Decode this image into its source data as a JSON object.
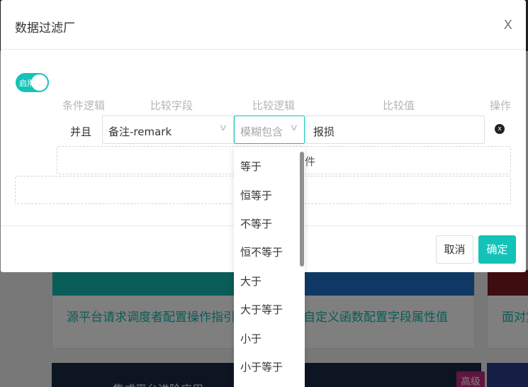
{
  "dialog": {
    "title": "数据过滤厂",
    "close_label": "X"
  },
  "toggle": {
    "label": "启用",
    "on": true
  },
  "headers": {
    "condition_logic": "条件逻辑",
    "compare_field": "比较字段",
    "compare_logic": "比较逻辑",
    "compare_value": "比较值",
    "action": "操作"
  },
  "row": {
    "logic": "并且",
    "field": "备注-remark",
    "operator_placeholder": "模糊包含",
    "value": "报损",
    "delete_icon": "x"
  },
  "add_condition_suffix": "件",
  "dropdown": {
    "options": [
      "等于",
      "恒等于",
      "不等于",
      "恒不等于",
      "大于",
      "大于等于",
      "小于",
      "小于等于"
    ]
  },
  "footer": {
    "cancel_label": "取消",
    "ok_label": "确定"
  },
  "background": {
    "card_titles": [
      "源平台请求调度者配置操作指引",
      "自定义函数配置字段属性值",
      "面对复"
    ],
    "dark_title": "集成平台进阶应用",
    "tag_label": "高级"
  },
  "colors": {
    "accent": "#14c3b8",
    "dark_banner": "#1d2a44",
    "tag": "#c12a7c"
  }
}
